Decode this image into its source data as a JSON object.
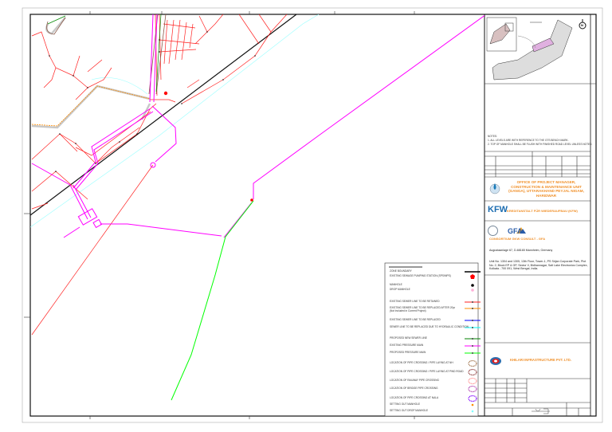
{
  "drawing": {
    "notes": {
      "heading": "NOTES:",
      "items": [
        "1. ALL LEVELS ARE WITH REFERENCE TO THE GTS BENCH MARK.",
        "2. TOP OF MANHOLE SHALL BE FLUSH WITH FINISHED ROAD LEVEL UNLESS NOTED."
      ]
    },
    "client": "OFFICE OF PROJECT MANAGER, CONSTRUCTION & MAINTENANCE UNIT (GANGA), UTTARAKHAND PEYJAL NIGAM, HARIDWAR",
    "funder_logo": "KFW",
    "funder": "KREDITANSTALT FÜR WIEDERAUFBAU (KFW)",
    "consultant_logo": "GFA",
    "consultant": "CONSORTIUM GKW CONSULT - GFA",
    "address_germany": "Augustaanlage 67, D-68165 Mannheim, Germany",
    "address_india": "Unit No. 1304 and 1305, 13th Floor, Tower-1, PS Srijan Corporate Park, Plot No. 2, Block EP & GP, Sector V, Bidhannagar, Salt Lake Electronics Complex, Kolkata - 700 091, West Bengal, India.",
    "contractor": "KHILARI INFRASTRUCTURE PVT. LTD.",
    "north_label": "N"
  },
  "legend": [
    {
      "label": "ZONE BOUNDARY",
      "symbol": "line",
      "color": "#000000"
    },
    {
      "label": "EXISTING SEWAGE PUMPING STATION (SPS/MPS)",
      "symbol": "pentagon",
      "color": "#ff0000"
    },
    {
      "label": "MANHOLE",
      "symbol": "dot",
      "color": "#000000"
    },
    {
      "label": "DROP MANHOLE",
      "symbol": "dot",
      "color": "#ffb0d8"
    },
    {
      "label": "EXISTING SEWER LINE TO BE RETAINED",
      "symbol": "line",
      "color": "#ff2020"
    },
    {
      "label": "EXISTING SEWER LINE TO BE REPLACED AFTER 20yr",
      "sub": "(Not included in Current Project)",
      "symbol": "line",
      "color": "#ff8c00"
    },
    {
      "label": "EXISTING SEWER LINE TO BE REPLACED",
      "symbol": "line",
      "color": "#0000ff"
    },
    {
      "label": "SEWER LINE TO BE REPLACED DUE TO HYDRAULIC CONDITION",
      "symbol": "line",
      "color": "#00ffff"
    },
    {
      "label": "PROPOSED NEW SEWER LINE",
      "symbol": "line",
      "color": "#008000"
    },
    {
      "label": "EXISTING PRESSURE MAIN",
      "symbol": "line",
      "color": "#ff00ff"
    },
    {
      "label": "PROPOSED PRESSURE MAIN",
      "symbol": "line",
      "color": "#00ff00"
    },
    {
      "label": "LOCATION OF PIPE CROSSING / PIPE LAYING AT NH",
      "symbol": "loop",
      "color": "#a0724a"
    },
    {
      "label": "LOCATION OF PIPE CROSSING / PIPE LAYING AT PWD ROAD",
      "symbol": "loop",
      "color": "#8b3a3a"
    },
    {
      "label": "LOCATION OF RAILWAY PIPE CROSSING",
      "symbol": "loop",
      "color": "#ff9090"
    },
    {
      "label": "LOCATION OF BRIDGE PIPE CROSSING",
      "symbol": "loop",
      "color": "#b040b0"
    },
    {
      "label": "LOCATION OF PIPE CROSSING AT NALA",
      "symbol": "loop",
      "color": "#8000ff"
    },
    {
      "label": "SETTING OUT MANHOLE",
      "symbol": "smalldot",
      "color": "#ff8c00"
    },
    {
      "label": "SETTING OUT DROP MANHOLE",
      "symbol": "smalldot",
      "color": "#80ffff"
    }
  ]
}
